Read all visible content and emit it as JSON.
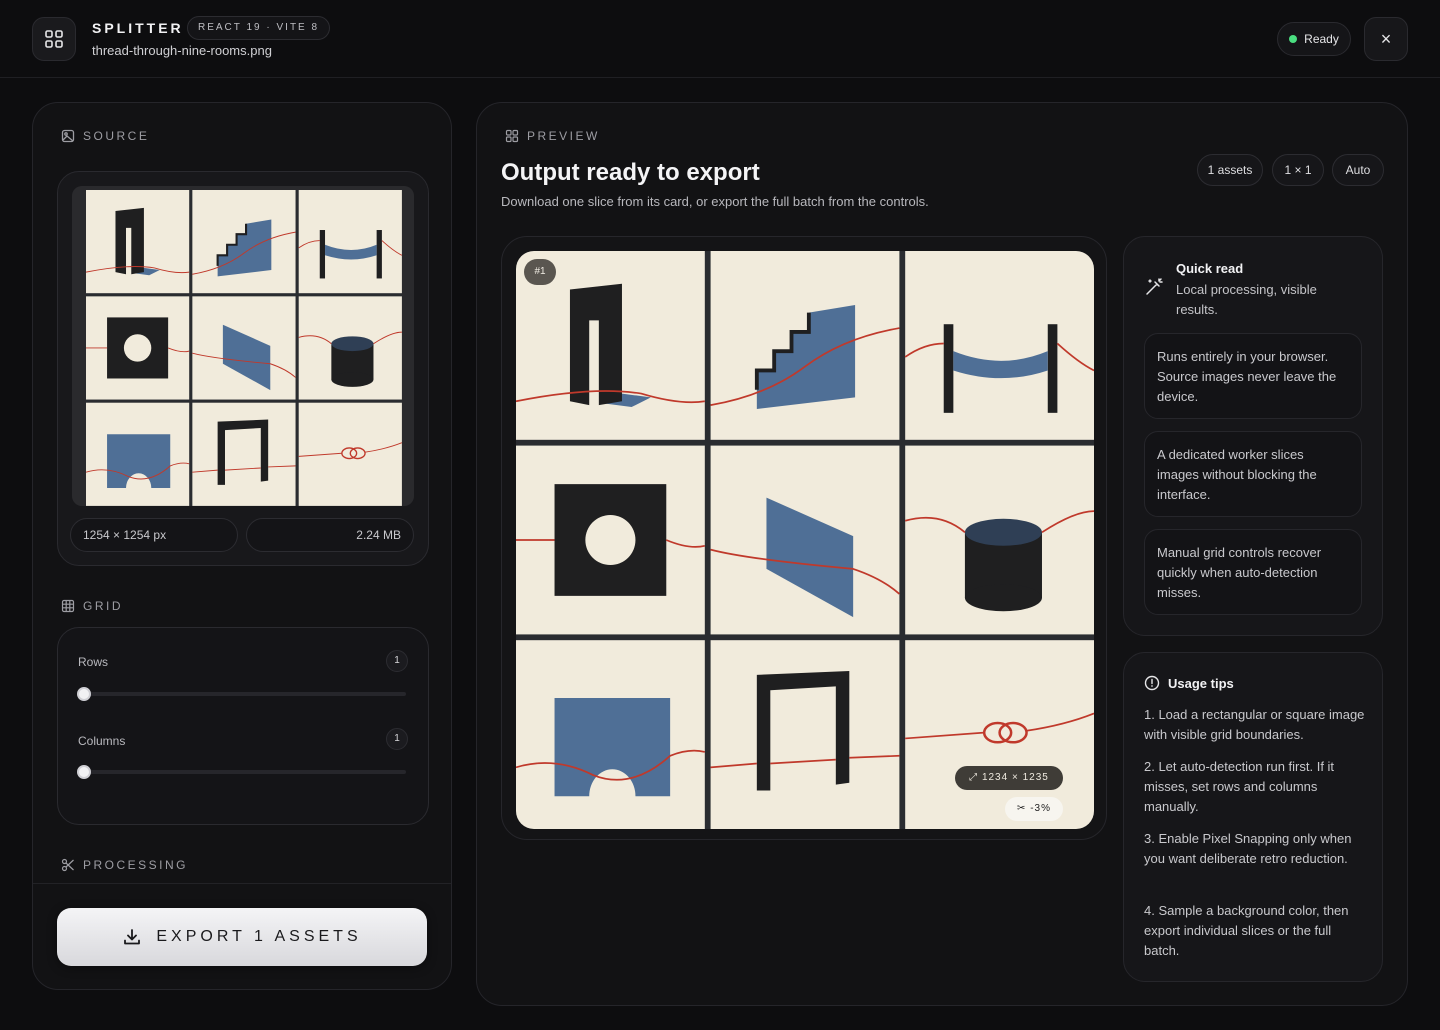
{
  "header": {
    "app_title": "SPLITTER",
    "version_badge": "REACT 19 · VITE 8",
    "file_name": "thread-through-nine-rooms.png",
    "status": "Ready",
    "close_icon": "×"
  },
  "source": {
    "label": "SOURCE",
    "dimensions": "1254 × 1254 px",
    "file_size": "2.24 MB"
  },
  "grid": {
    "label": "GRID",
    "rows_label": "Rows",
    "rows_value": "1",
    "columns_label": "Columns",
    "columns_value": "1"
  },
  "processing": {
    "label": "PROCESSING",
    "export_label": "EXPORT 1 ASSETS"
  },
  "preview": {
    "label": "PREVIEW",
    "title": "Output ready to export",
    "subtitle": "Download one slice from its card, or export the full batch from the controls.",
    "chips": [
      "1 assets",
      "1 × 1",
      "Auto"
    ],
    "slice_badge": "#1",
    "dimension_badge": "1234 × 1235",
    "trim_badge": "-3%"
  },
  "quick_read": {
    "title": "Quick read",
    "subtitle": "Local processing, visible results.",
    "items": [
      "Runs entirely in your browser. Source images never leave the device.",
      "A dedicated worker slices images without blocking the interface.",
      "Manual grid controls recover quickly when auto-detection misses."
    ]
  },
  "usage_tips": {
    "title": "Usage tips",
    "tips": [
      "1. Load a rectangular or square image with visible grid boundaries.",
      "2. Let auto-detection run first. If it misses, set rows and columns manually.",
      "3. Enable Pixel Snapping only when you want deliberate retro reduction.",
      "4. Sample a background color, then export individual slices or the full batch."
    ]
  },
  "colors": {
    "background": "#0d0d0f",
    "accent_ready": "#4ade80",
    "paper": "#f1ebdc",
    "ink": "#1f1f20",
    "slate_blue": "#4f6f96",
    "thread_red": "#c0392b"
  }
}
